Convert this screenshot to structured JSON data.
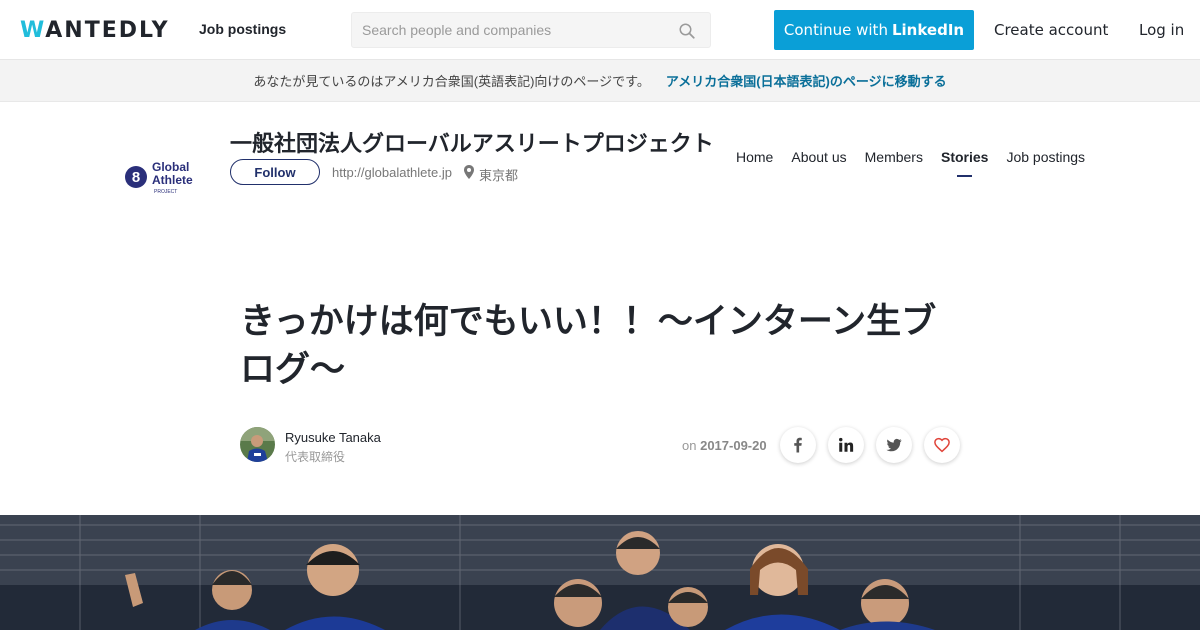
{
  "header": {
    "logo": "WANTEDLY",
    "nav_job_postings": "Job postings",
    "search_placeholder": "Search people and companies",
    "linkedin_prefix": "Continue with",
    "linkedin_brand": "LinkedIn",
    "create_account": "Create account",
    "login": "Log in",
    "accent_color": "#0a9fd7"
  },
  "banner": {
    "text": "あなたが見ているのはアメリカ合衆国(英語表記)向けのページです。",
    "link": "アメリカ合衆国(日本語表記)のページに移動する"
  },
  "company": {
    "logo_line1": "Global",
    "logo_line2": "Athlete",
    "logo_line3": "PROJECT",
    "name": "一般社団法人グローバルアスリートプロジェクト",
    "follow": "Follow",
    "url": "http://globalathlete.jp",
    "location": "東京都",
    "nav": [
      {
        "label": "Home"
      },
      {
        "label": "About us"
      },
      {
        "label": "Members"
      },
      {
        "label": "Stories",
        "active": true
      },
      {
        "label": "Job postings"
      }
    ]
  },
  "article": {
    "title": "きっかけは何でもいい！！～インターン生ブログ～",
    "author_name": "Ryusuke Tanaka",
    "author_role": "代表取締役",
    "date_prefix": "on",
    "date": "2017-09-20"
  },
  "share": {
    "icons": [
      "facebook-icon",
      "linkedin-icon",
      "twitter-icon",
      "heart-icon"
    ]
  }
}
